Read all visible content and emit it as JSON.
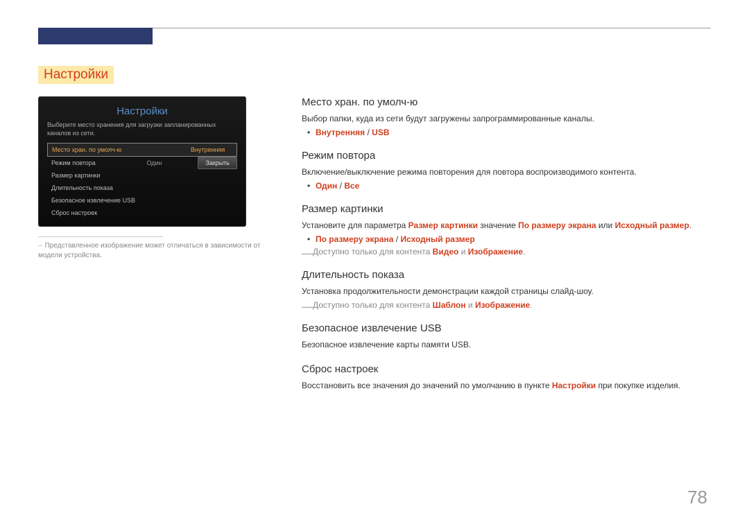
{
  "page_number": "78",
  "section_title": "Настройки",
  "mock_ui": {
    "title": "Настройки",
    "description": "Выберите место хранения для загрузки запланированных каналов из сети.",
    "rows": [
      {
        "label": "Место хран. по умолч-ю",
        "value": "Внутренняя"
      },
      {
        "label": "Режим повтора",
        "value": "Один"
      },
      {
        "label": "Размер картинки",
        "value": ""
      },
      {
        "label": "Длительность показа",
        "value": ""
      },
      {
        "label": "Безопасное извлечение USB",
        "value": ""
      },
      {
        "label": "Сброс настроек",
        "value": ""
      }
    ],
    "close_button": "Закрыть"
  },
  "footnote": "Представленное изображение может отличаться в зависимости от модели устройства.",
  "sections": [
    {
      "heading": "Место хран. по умолч-ю",
      "body": "Выбор папки, куда из сети будут загружены запрограммированные каналы.",
      "bullet": {
        "parts": [
          "Внутренняя",
          "USB"
        ]
      }
    },
    {
      "heading": "Режим повтора",
      "body": "Включение/выключение режима повторения для повтора воспроизводимого контента.",
      "bullet": {
        "parts": [
          "Один",
          "Все"
        ]
      }
    },
    {
      "heading": "Размер картинки",
      "body_complex": {
        "pre": "Установите для параметра ",
        "h1": "Размер картинки",
        "mid": " значение ",
        "h2": "По размеру экрана",
        "or": " или ",
        "h3": "Исходный размер",
        "post": "."
      },
      "bullet": {
        "parts": [
          "По размеру экрана",
          "Исходный размер"
        ]
      },
      "note": {
        "pre": "Доступно только для контента ",
        "h1": "Видео",
        "and": " и ",
        "h2": "Изображение",
        "post": "."
      }
    },
    {
      "heading": "Длительность показа",
      "body": "Установка продолжительности демонстрации каждой страницы слайд-шоу.",
      "note": {
        "pre": "Доступно только для контента ",
        "h1": "Шаблон",
        "and": " и ",
        "h2": "Изображение",
        "post": "."
      }
    },
    {
      "heading": "Безопасное извлечение USB",
      "body": "Безопасное извлечение карты памяти USB."
    },
    {
      "heading": "Сброс настроек",
      "body_complex2": {
        "pre": "Восстановить все значения до значений по умолчанию в пункте ",
        "h1": "Настройки",
        "post": " при покупке изделия."
      }
    }
  ]
}
